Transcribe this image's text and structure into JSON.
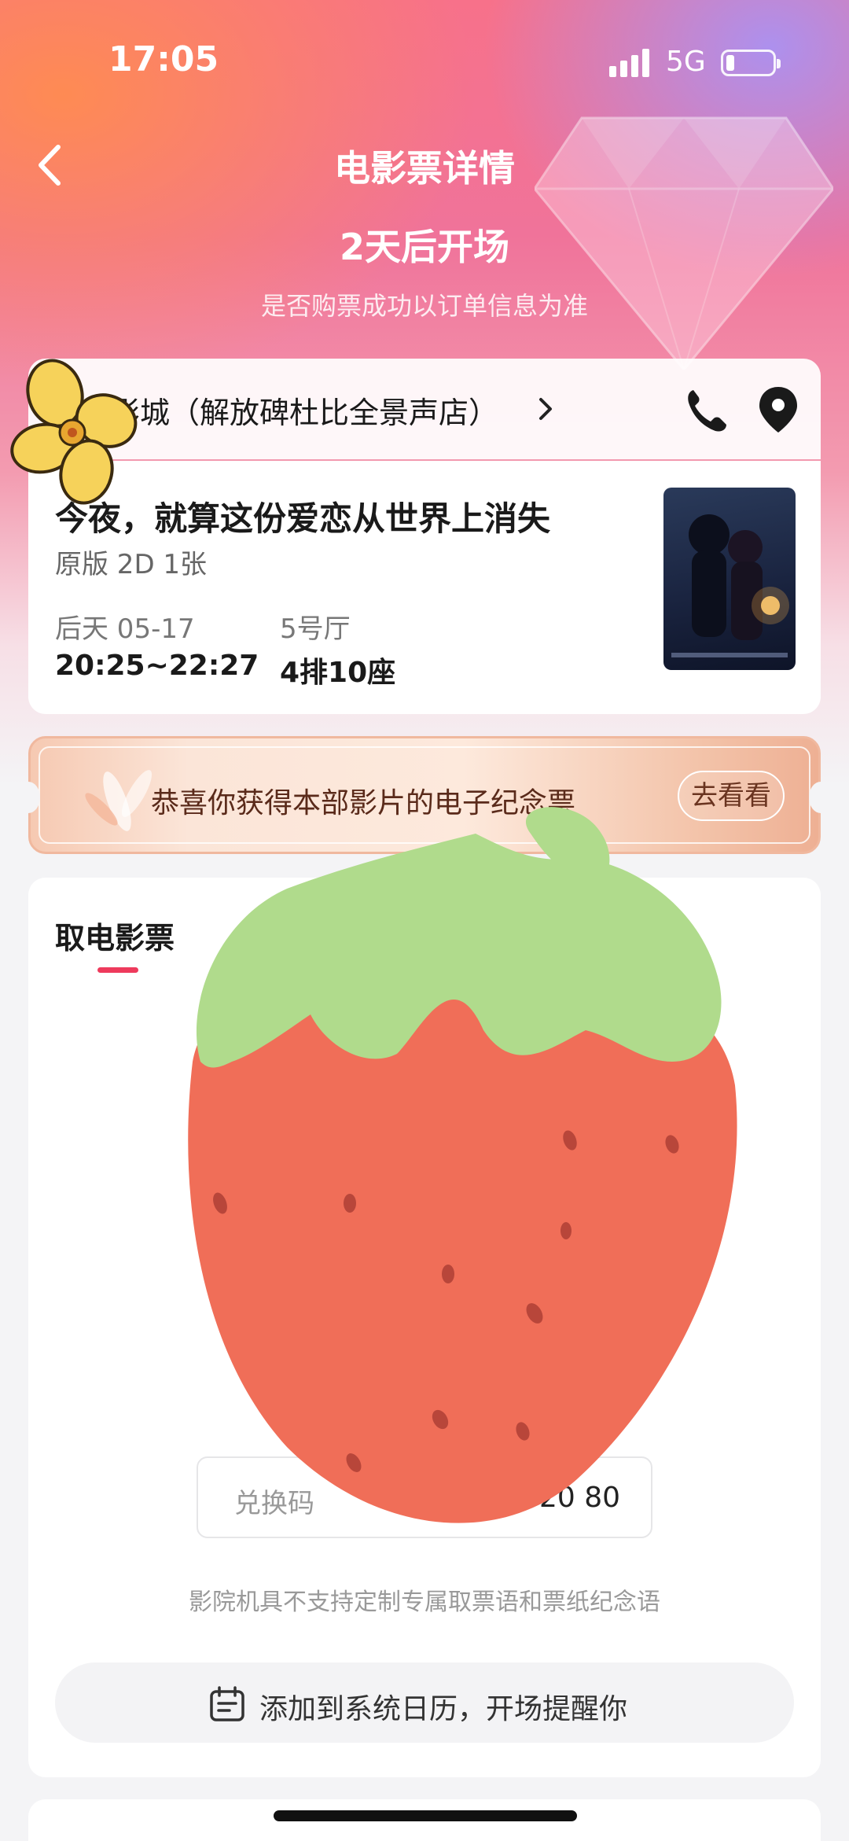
{
  "status_bar": {
    "time": "17:05",
    "network": "5G"
  },
  "header": {
    "title": "电影票详情",
    "countdown": "2天后开场",
    "notice": "是否购票成功以订单信息为准"
  },
  "cinema": {
    "name": "影城（解放碑杜比全景声店）"
  },
  "movie": {
    "title": "今夜，就算这份爱恋从世界上消失",
    "meta": "原版 2D 1张",
    "date": "后天 05-17",
    "time": "20:25~22:27",
    "hall": "5号厅",
    "seat": "4排10座"
  },
  "banner": {
    "text": "恭喜你获得本部影片的电子纪念票",
    "button": "去看看"
  },
  "ticket": {
    "tab": "取电影票",
    "code_label": "兑换码",
    "code_value": "20 80",
    "tip": "影院机具不支持定制专属取票语和票纸纪念语",
    "calendar_button": "添加到系统日历，开场提醒你"
  },
  "colors": {
    "accent": "#ee3a5c",
    "sticker_red": "#f06e58",
    "sticker_green": "#b0db8c"
  }
}
